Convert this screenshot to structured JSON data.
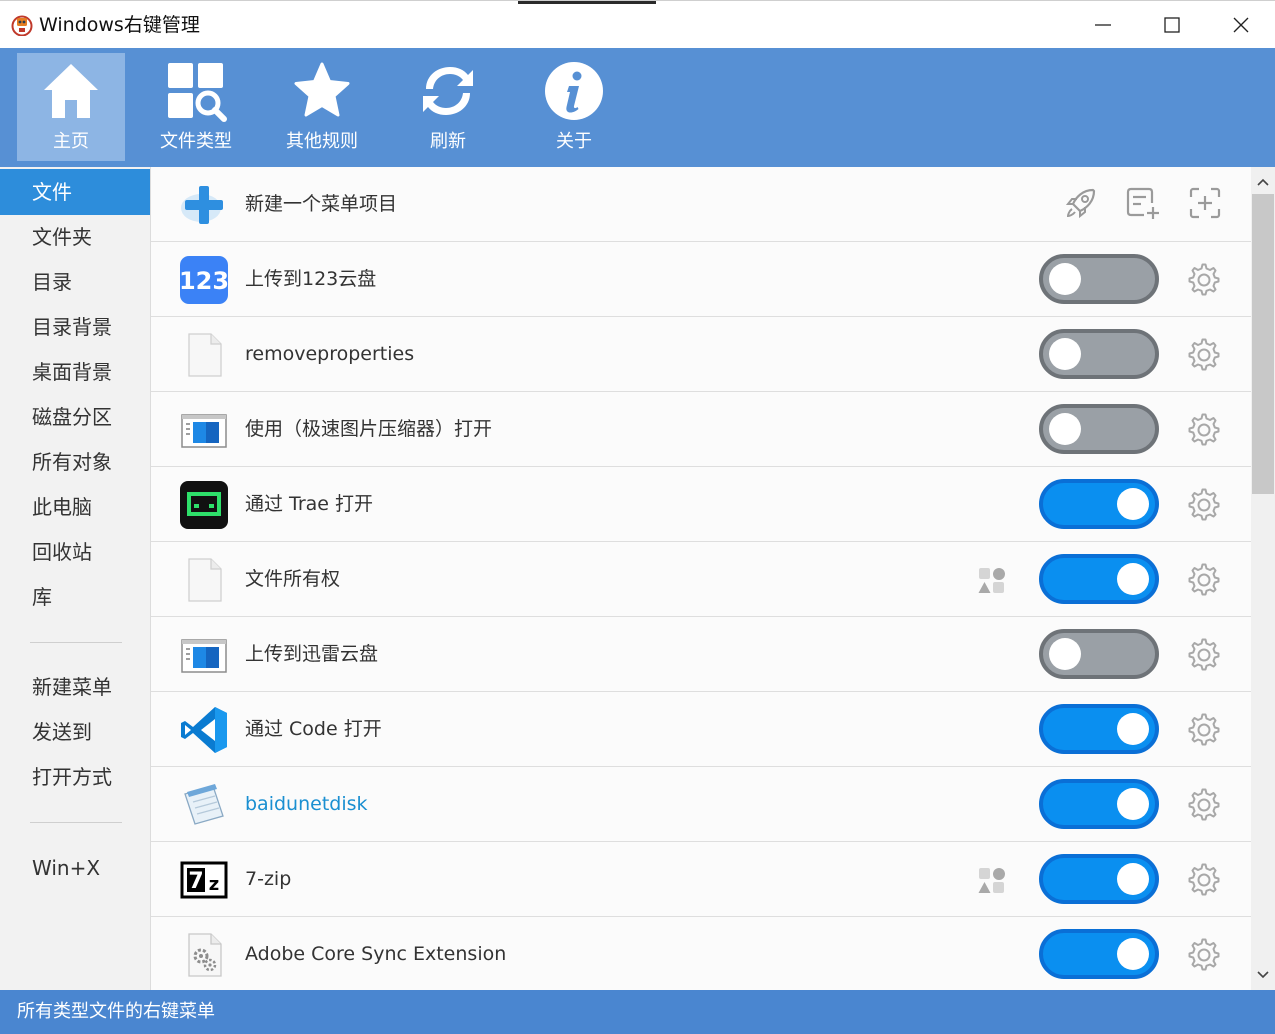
{
  "window": {
    "title": "Windows右键管理"
  },
  "toolbar": {
    "items": [
      {
        "label": "主页",
        "icon": "home-icon"
      },
      {
        "label": "文件类型",
        "icon": "file-types-icon"
      },
      {
        "label": "其他规则",
        "icon": "star-icon"
      },
      {
        "label": "刷新",
        "icon": "refresh-icon"
      },
      {
        "label": "关于",
        "icon": "info-icon"
      }
    ]
  },
  "sidebar": {
    "items": [
      {
        "label": "文件"
      },
      {
        "label": "文件夹"
      },
      {
        "label": "目录"
      },
      {
        "label": "目录背景"
      },
      {
        "label": "桌面背景"
      },
      {
        "label": "磁盘分区"
      },
      {
        "label": "所有对象"
      },
      {
        "label": "此电脑"
      },
      {
        "label": "回收站"
      },
      {
        "label": "库"
      },
      {
        "label": "新建菜单"
      },
      {
        "label": "发送到"
      },
      {
        "label": "打开方式"
      },
      {
        "label": "Win+X"
      }
    ],
    "active_index": 0
  },
  "list": {
    "new_item_label": "新建一个菜单项目",
    "items": [
      {
        "label": "上传到123云盘",
        "enabled": false,
        "icon": "123pan-icon"
      },
      {
        "label": "removeproperties",
        "enabled": false,
        "icon": "blank-file-icon"
      },
      {
        "label": "使用（极速图片压缩器）打开",
        "enabled": false,
        "icon": "app-window-icon"
      },
      {
        "label": "通过 Trae 打开",
        "enabled": true,
        "icon": "trae-icon"
      },
      {
        "label": "文件所有权",
        "enabled": true,
        "icon": "blank-file-icon",
        "extra": "shapes-icon"
      },
      {
        "label": "上传到迅雷云盘",
        "enabled": false,
        "icon": "app-window-icon"
      },
      {
        "label": "通过 Code 打开",
        "enabled": true,
        "icon": "vscode-icon"
      },
      {
        "label": "baidunetdisk",
        "enabled": true,
        "icon": "notepad-icon",
        "link": true
      },
      {
        "label": "7-zip",
        "enabled": true,
        "icon": "7zip-icon",
        "extra": "shapes-icon"
      },
      {
        "label": "Adobe Core Sync Extension",
        "enabled": true,
        "icon": "gear-file-icon"
      }
    ]
  },
  "status": {
    "text": "所有类型文件的右键菜单"
  },
  "colors": {
    "toolbar_bg": "#5790d4",
    "toolbar_active": "#8db5e4",
    "sidebar_active": "#2d8ddb",
    "toggle_on": "#0a8ff0",
    "toggle_off": "#9aa0a6",
    "statusbar_bg": "#4a86d0"
  }
}
